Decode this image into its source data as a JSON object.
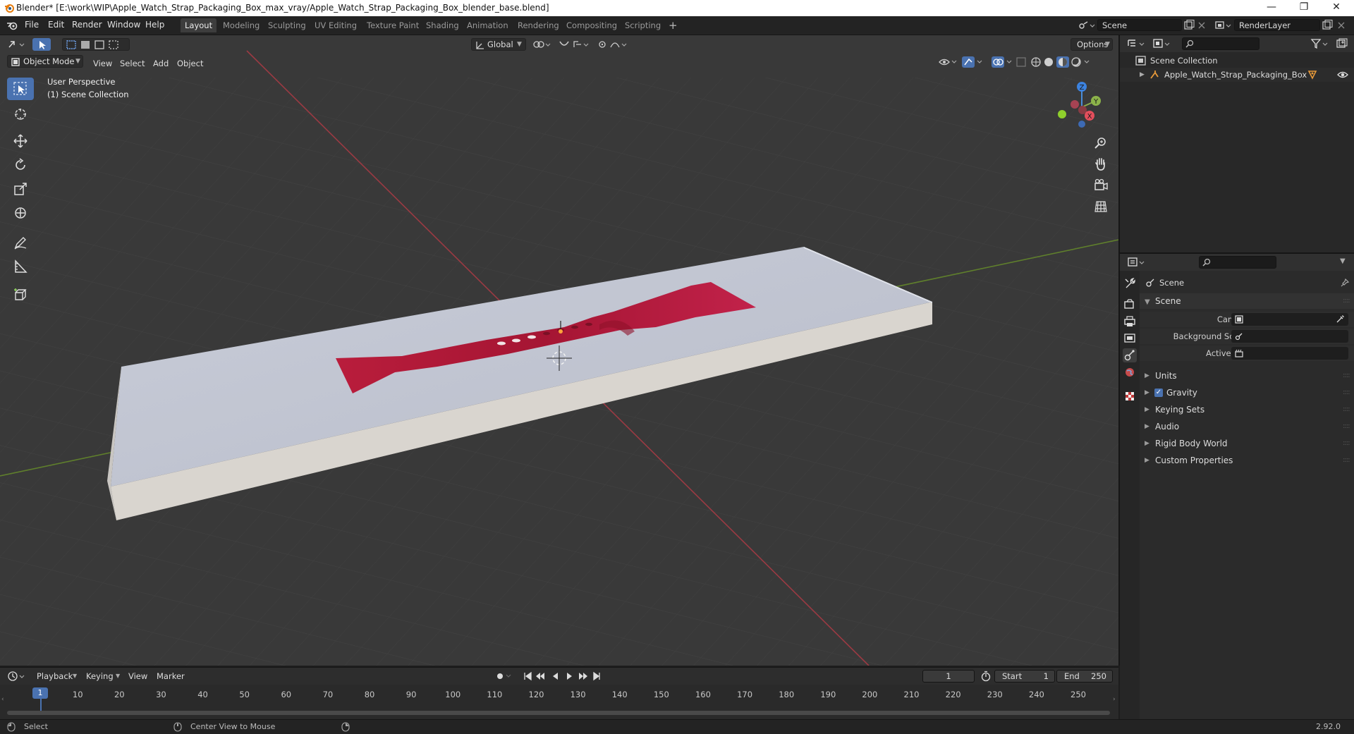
{
  "window": {
    "title": "Blender* [E:\\work\\WIP\\Apple_Watch_Strap_Packaging_Box_max_vray/Apple_Watch_Strap_Packaging_Box_blender_base.blend]"
  },
  "menu": [
    "File",
    "Edit",
    "Render",
    "Window",
    "Help"
  ],
  "workspaces": [
    "Layout",
    "Modeling",
    "Sculpting",
    "UV Editing",
    "Texture Paint",
    "Shading",
    "Animation",
    "Rendering",
    "Compositing",
    "Scripting"
  ],
  "active_workspace": "Layout",
  "scene_field": "Scene",
  "renderlayer_field": "RenderLayer",
  "viewport": {
    "mode": "Object Mode",
    "menus": [
      "View",
      "Select",
      "Add",
      "Object"
    ],
    "transform_orientation": "Global",
    "options_label": "Options",
    "perspective_label": "User Perspective",
    "collection_label": "(1) Scene Collection",
    "axes": {
      "x": "X",
      "y": "Y",
      "z": "Z"
    }
  },
  "outliner": {
    "root": "Scene Collection",
    "items": [
      {
        "label": "Apple_Watch_Strap_Packaging_Box"
      }
    ]
  },
  "properties": {
    "context_title": "Scene",
    "panel_title": "Scene",
    "fields": [
      {
        "label": "Camera",
        "value": ""
      },
      {
        "label": "Background Scene",
        "value": ""
      },
      {
        "label": "Active Clip",
        "value": ""
      }
    ],
    "subpanels": [
      "Units",
      "Gravity",
      "Keying Sets",
      "Audio",
      "Rigid Body World",
      "Custom Properties"
    ],
    "gravity_checked": true
  },
  "timeline": {
    "menus": [
      "Playback",
      "Keying",
      "View",
      "Marker"
    ],
    "current_frame": "1",
    "start_label": "Start",
    "start_value": "1",
    "end_label": "End",
    "end_value": "250",
    "ruler": [
      "10",
      "20",
      "30",
      "40",
      "50",
      "60",
      "70",
      "80",
      "90",
      "100",
      "110",
      "120",
      "130",
      "140",
      "150",
      "160",
      "170",
      "180",
      "190",
      "200",
      "210",
      "220",
      "230",
      "240",
      "250"
    ],
    "playhead_label": "1"
  },
  "statusbar": {
    "left": "Select",
    "middle": "Center View to Mouse",
    "version": "2.92.0"
  },
  "colors": {
    "accent": "#4a72b0",
    "strap": "#b0203a",
    "box_top": "#c4c9d6",
    "x_axis": "#b03c46",
    "y_axis": "#6b8f2f"
  }
}
